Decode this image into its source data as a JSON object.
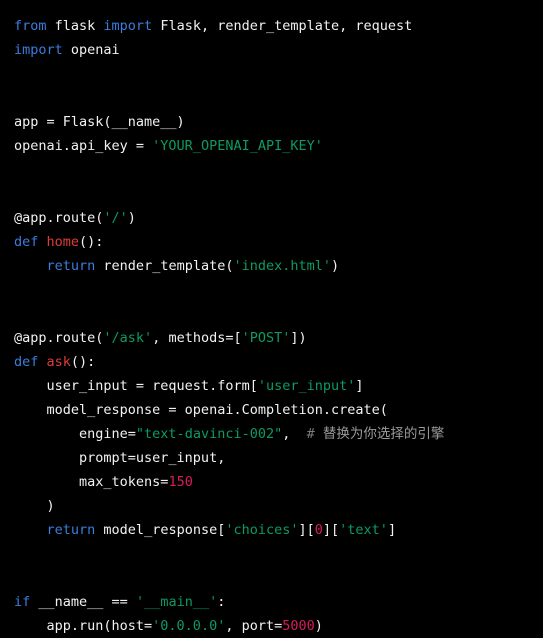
{
  "editor": {
    "background_color": "#000000",
    "language": "python",
    "theme_colors": {
      "keyword": "#3b7ddd",
      "string": "#0c9b62",
      "number": "#d81b60",
      "function_name": "#e03b3b",
      "plain_text": "#f2f2f2",
      "comment": "#7a7a7a"
    },
    "lines": [
      {
        "n": 1,
        "tokens": [
          {
            "t": "from",
            "c": "kw"
          },
          {
            "t": " flask ",
            "c": "plain"
          },
          {
            "t": "import",
            "c": "kw"
          },
          {
            "t": " Flask, render_template, request",
            "c": "plain"
          }
        ]
      },
      {
        "n": 2,
        "tokens": [
          {
            "t": "import",
            "c": "kw"
          },
          {
            "t": " openai",
            "c": "plain"
          }
        ]
      },
      {
        "n": 3,
        "tokens": []
      },
      {
        "n": 4,
        "tokens": []
      },
      {
        "n": 5,
        "tokens": [
          {
            "t": "app = Flask(__name__)",
            "c": "plain"
          }
        ]
      },
      {
        "n": 6,
        "tokens": [
          {
            "t": "openai.api_key = ",
            "c": "plain"
          },
          {
            "t": "'YOUR_OPENAI_API_KEY'",
            "c": "str"
          }
        ]
      },
      {
        "n": 7,
        "tokens": []
      },
      {
        "n": 8,
        "tokens": []
      },
      {
        "n": 9,
        "tokens": [
          {
            "t": "@app.route(",
            "c": "deco"
          },
          {
            "t": "'/'",
            "c": "str"
          },
          {
            "t": ")",
            "c": "deco"
          }
        ]
      },
      {
        "n": 10,
        "tokens": [
          {
            "t": "def",
            "c": "kw"
          },
          {
            "t": " ",
            "c": "plain"
          },
          {
            "t": "home",
            "c": "fn"
          },
          {
            "t": "():",
            "c": "plain"
          }
        ]
      },
      {
        "n": 11,
        "tokens": [
          {
            "t": "    ",
            "c": "plain"
          },
          {
            "t": "return",
            "c": "kw"
          },
          {
            "t": " render_template(",
            "c": "plain"
          },
          {
            "t": "'index.html'",
            "c": "str"
          },
          {
            "t": ")",
            "c": "plain"
          }
        ]
      },
      {
        "n": 12,
        "tokens": []
      },
      {
        "n": 13,
        "tokens": []
      },
      {
        "n": 14,
        "tokens": [
          {
            "t": "@app.route(",
            "c": "deco"
          },
          {
            "t": "'/ask'",
            "c": "str"
          },
          {
            "t": ", methods=[",
            "c": "deco"
          },
          {
            "t": "'POST'",
            "c": "str"
          },
          {
            "t": "])",
            "c": "deco"
          }
        ]
      },
      {
        "n": 15,
        "tokens": [
          {
            "t": "def",
            "c": "kw"
          },
          {
            "t": " ",
            "c": "plain"
          },
          {
            "t": "ask",
            "c": "fn"
          },
          {
            "t": "():",
            "c": "plain"
          }
        ]
      },
      {
        "n": 16,
        "tokens": [
          {
            "t": "    user_input = request.form[",
            "c": "plain"
          },
          {
            "t": "'user_input'",
            "c": "str"
          },
          {
            "t": "]",
            "c": "plain"
          }
        ]
      },
      {
        "n": 17,
        "tokens": [
          {
            "t": "    model_response = openai.Completion.create(",
            "c": "plain"
          }
        ]
      },
      {
        "n": 18,
        "tokens": [
          {
            "t": "        engine=",
            "c": "plain"
          },
          {
            "t": "\"text-davinci-002\"",
            "c": "str"
          },
          {
            "t": ",  ",
            "c": "plain"
          },
          {
            "t": "# ",
            "c": "cmt"
          },
          {
            "t": "替换为你选择的引擎",
            "c": "cn"
          }
        ]
      },
      {
        "n": 19,
        "tokens": [
          {
            "t": "        prompt=user_input,",
            "c": "plain"
          }
        ]
      },
      {
        "n": 20,
        "tokens": [
          {
            "t": "        max_tokens=",
            "c": "plain"
          },
          {
            "t": "150",
            "c": "num"
          }
        ]
      },
      {
        "n": 21,
        "tokens": [
          {
            "t": "    )",
            "c": "plain"
          }
        ]
      },
      {
        "n": 22,
        "tokens": [
          {
            "t": "    ",
            "c": "plain"
          },
          {
            "t": "return",
            "c": "kw"
          },
          {
            "t": " model_response[",
            "c": "plain"
          },
          {
            "t": "'choices'",
            "c": "str"
          },
          {
            "t": "][",
            "c": "plain"
          },
          {
            "t": "0",
            "c": "num"
          },
          {
            "t": "][",
            "c": "plain"
          },
          {
            "t": "'text'",
            "c": "str"
          },
          {
            "t": "]",
            "c": "plain"
          }
        ]
      },
      {
        "n": 23,
        "tokens": []
      },
      {
        "n": 24,
        "tokens": []
      },
      {
        "n": 25,
        "tokens": [
          {
            "t": "if",
            "c": "kw"
          },
          {
            "t": " __name__ == ",
            "c": "plain"
          },
          {
            "t": "'__main__'",
            "c": "str"
          },
          {
            "t": ":",
            "c": "plain"
          }
        ]
      },
      {
        "n": 26,
        "tokens": [
          {
            "t": "    app.run(host=",
            "c": "plain"
          },
          {
            "t": "'0.0.0.0'",
            "c": "str"
          },
          {
            "t": ", port=",
            "c": "plain"
          },
          {
            "t": "5000",
            "c": "num"
          },
          {
            "t": ")",
            "c": "plain"
          }
        ]
      }
    ]
  }
}
